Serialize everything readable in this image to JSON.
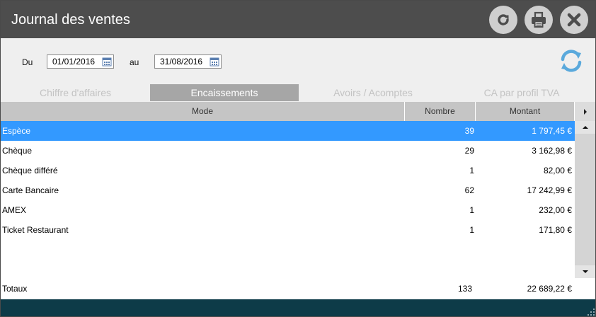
{
  "window": {
    "title": "Journal des ventes"
  },
  "title_buttons": [
    {
      "icon": "reload-icon"
    },
    {
      "icon": "print-icon"
    },
    {
      "icon": "close-icon"
    }
  ],
  "filter": {
    "from_label": "Du",
    "from_value": "01/01/2016",
    "to_label": "au",
    "to_value": "31/08/2016",
    "refresh_icon": "refresh-icon"
  },
  "tabs": [
    {
      "label": "Chiffre d'affaires",
      "active": false
    },
    {
      "label": "Encaissements",
      "active": true
    },
    {
      "label": "Avoirs / Acomptes",
      "active": false
    },
    {
      "label": "CA par profil TVA",
      "active": false
    }
  ],
  "grid": {
    "columns": [
      "Mode",
      "Nombre",
      "Montant"
    ],
    "rows": [
      {
        "mode": "Espèce",
        "nombre": "39",
        "montant": "1 797,45 €",
        "selected": true
      },
      {
        "mode": "Chèque",
        "nombre": "29",
        "montant": "3 162,98 €"
      },
      {
        "mode": "Chèque différé",
        "nombre": "1",
        "montant": "82,00 €"
      },
      {
        "mode": "Carte Bancaire",
        "nombre": "62",
        "montant": "17 242,99 €"
      },
      {
        "mode": "AMEX",
        "nombre": "1",
        "montant": "232,00 €"
      },
      {
        "mode": "Ticket Restaurant",
        "nombre": "1",
        "montant": "171,80 €"
      }
    ],
    "totals": {
      "label": "Totaux",
      "nombre": "133",
      "montant": "22 689,22 €"
    }
  },
  "colors": {
    "titlebar": "#4d4d4d",
    "selected_row": "#3399ff",
    "footer": "#0d3b48",
    "refresh_accent": "#5aa9dc"
  }
}
